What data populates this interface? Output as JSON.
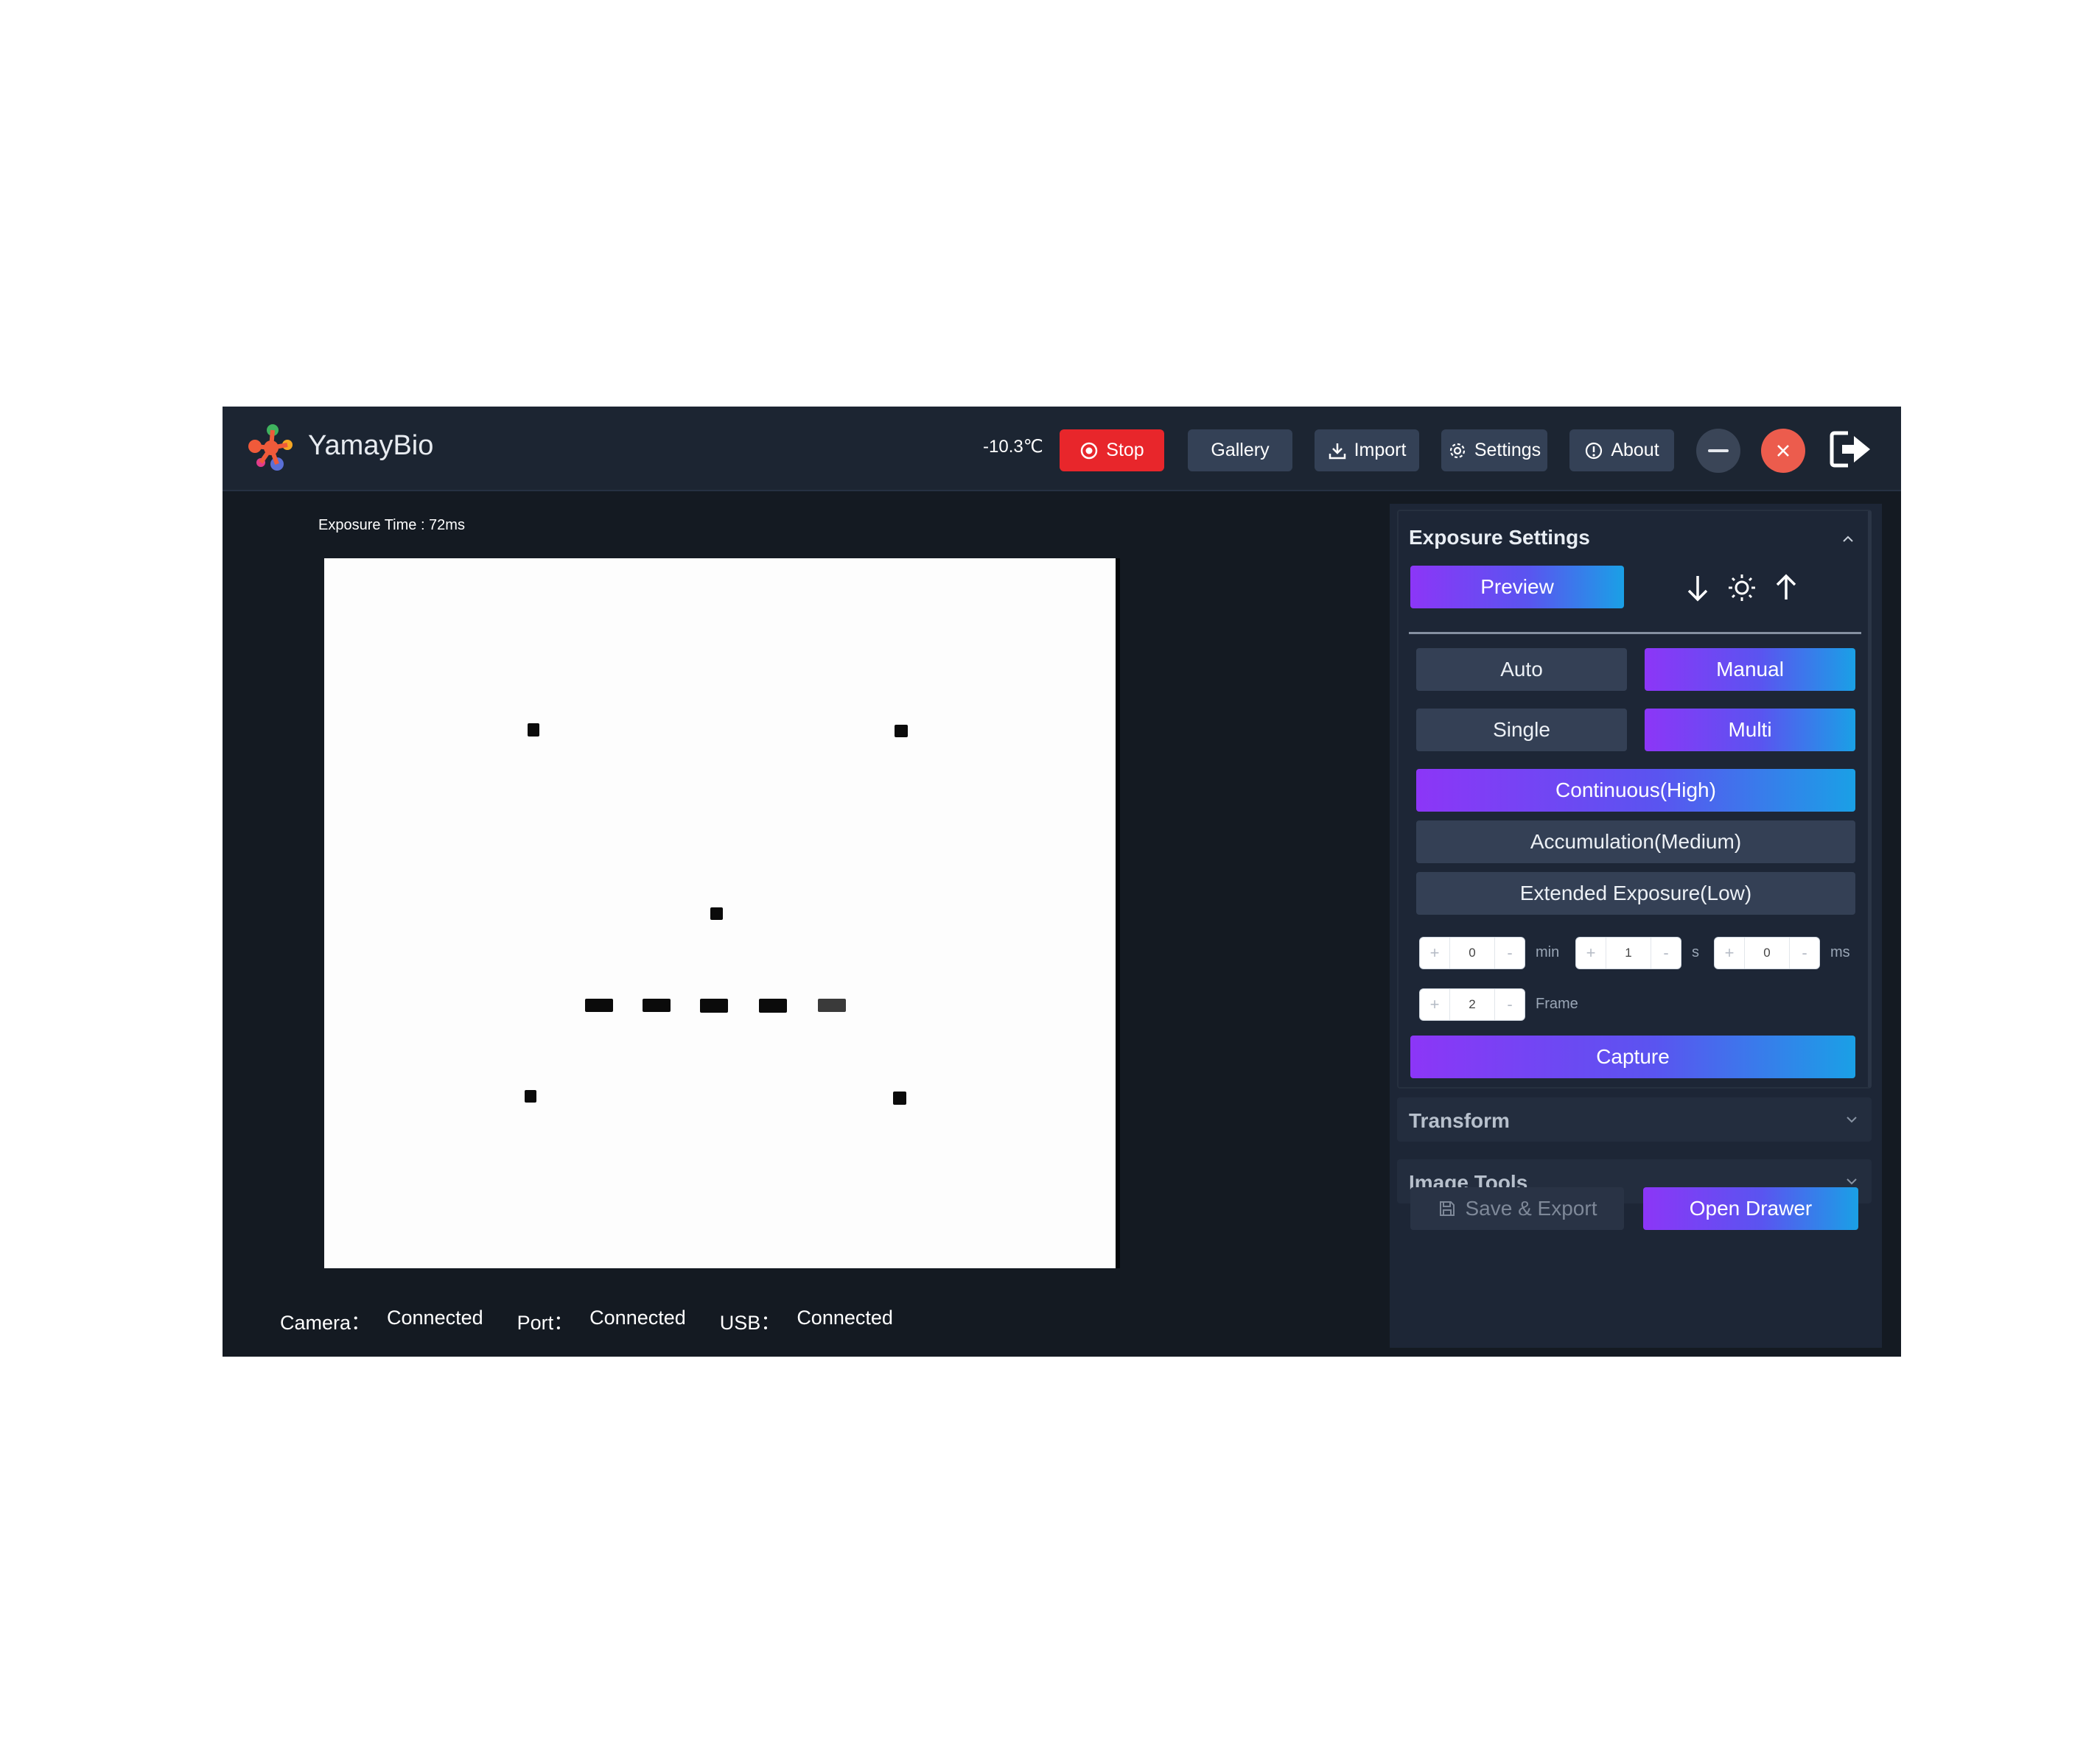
{
  "header": {
    "brand": "YamayBio",
    "temperature": "-10.3℃",
    "stop_label": "Stop",
    "gallery_label": "Gallery",
    "import_label": "Import",
    "settings_label": "Settings",
    "about_label": "About",
    "logo_colors": [
      "#f05a3a",
      "#3fb35e",
      "#f6a623",
      "#5a6fd6",
      "#e23c8a"
    ]
  },
  "viewer": {
    "exposure_time": "Exposure Time : 72ms"
  },
  "status": {
    "camera_label": "Camera：",
    "camera_value": "Connected",
    "port_label": "Port：",
    "port_value": "Connected",
    "usb_label": "USB：",
    "usb_value": "Connected"
  },
  "exposure": {
    "title": "Exposure Settings",
    "preview_label": "Preview",
    "auto_label": "Auto",
    "manual_label": "Manual",
    "single_label": "Single",
    "multi_label": "Multi",
    "continuous_label": "Continuous(High)",
    "accumulation_label": "Accumulation(Medium)",
    "extended_label": "Extended Exposure(Low)",
    "min_value": "0",
    "min_unit": "min",
    "sec_value": "1",
    "sec_unit": "s",
    "ms_value": "0",
    "ms_unit": "ms",
    "frame_value": "2",
    "frame_unit": "Frame",
    "capture_label": "Capture",
    "plus": "+",
    "minus": "-"
  },
  "transform": {
    "title": "Transform"
  },
  "image_tools": {
    "title": "Image Tools"
  },
  "footer": {
    "save_label": "Save & Export",
    "drawer_label": "Open Drawer"
  },
  "colors": {
    "accent_gradient_start": "#8c36f7",
    "accent_gradient_end": "#1aa0e6",
    "stop": "#e8262b",
    "close": "#ec5c4d"
  }
}
